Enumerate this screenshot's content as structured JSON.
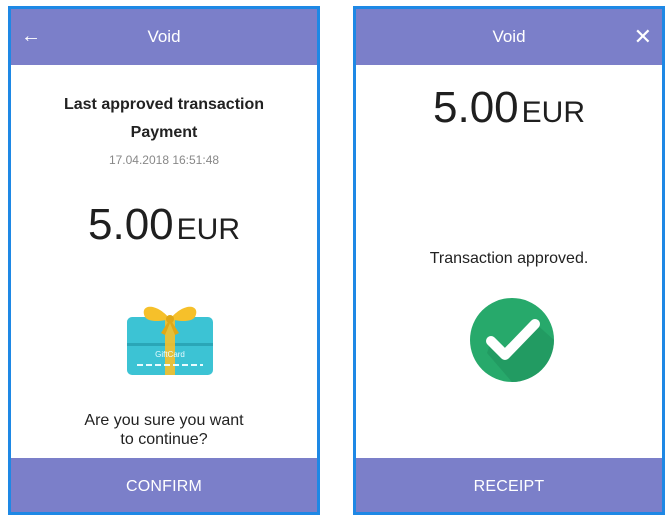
{
  "left_screen": {
    "topbar": {
      "back_icon": "←",
      "title": "Void"
    },
    "heading_line1": "Last approved transaction",
    "heading_line2": "Payment",
    "datetime": "17.04.2018 16:51:48",
    "amount": {
      "value": "5.00",
      "currency": "EUR"
    },
    "card_icon_text": "GiftCard",
    "question_line1": "Are you sure you want",
    "question_line2": "to continue?",
    "confirm_label": "CONFIRM"
  },
  "right_screen": {
    "topbar": {
      "title": "Void",
      "close_icon": "✕"
    },
    "amount": {
      "value": "5.00",
      "currency": "EUR"
    },
    "status_message": "Transaction approved.",
    "receipt_label": "RECEIPT"
  },
  "colors": {
    "bar": "#7b7fc9",
    "frame": "#1e88e5",
    "success": "#27a96b",
    "card": "#3cc3d4",
    "bow": "#f6c02a"
  }
}
